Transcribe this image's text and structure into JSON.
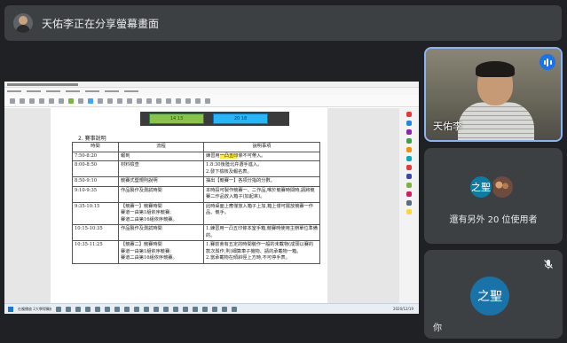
{
  "banner": {
    "message": "天佑李正在分享螢幕畫面",
    "avatar_icon": "user-avatar"
  },
  "shared_screen": {
    "doc_boxes": {
      "green_label": "14 13",
      "blue_label": "20 18"
    },
    "section_title": "2. 賽事說明",
    "table": {
      "headers": [
        "時間",
        "流程",
        "說明事項"
      ],
      "rows": [
        {
          "time": "7:50-8:20",
          "flow": "報到",
          "note_pre": "練習用",
          "note_hl": "一凸五印",
          "note_post": "條不可帶入。"
        },
        {
          "time": "8:00-8:50",
          "flow": "材料檢查",
          "note": "1.8:30後陸北弁選手進入。\n2.發下檢核及報名表。"
        },
        {
          "time": "8:50-9:10",
          "flow": "競賽式暨規則說明",
          "note": "抽出【競賽一】各項分指的分數。"
        },
        {
          "time": "9:10-9:35",
          "flow": "作品製作及測試時間",
          "note": "本時段可製作競賽一、二作品,唯於競賽時間時,請將競賽二作品放入箱子(加起來)。"
        },
        {
          "time": "9:35-10:15",
          "flow": "【競賽一】競賽時間\n賽道一由第1組依序競賽;\n賽道二由第16組依序競賽。",
          "note": "此時桌面上應僅放入箱子上加,箱上僅可擺放競賽一作品、競手。"
        },
        {
          "time": "10:15-10:35",
          "flow": "作品製作及測試時間",
          "note": "1.練習用一凸五印條本室手箱,競賽時使用主辦單位準備的。"
        },
        {
          "time": "10:35-11:25",
          "flow": "【競賽二】競賽時間\n賽道一由第1組依序競賽;\n賽道二由第16組依序競賽。",
          "note": "1.賽前會有五定的時間裝作一般的未載物(成頭以賽的款次與作,則)細算車子機物、請的承載物一箱。\n2.當承載物在傾斜徑上方時,不可停手表。"
        }
      ]
    },
    "taskbar": {
      "task_label": "在複播放 2大學得醫練",
      "clock": "2020/12/19"
    }
  },
  "tiles": {
    "presenter": {
      "name": "天佑李"
    },
    "others": {
      "avatar_text": "之聖",
      "text": "還有另外 20 位使用者"
    },
    "self": {
      "avatar_text": "之聖",
      "name": "你"
    }
  },
  "colors": {
    "accent": "#1a73e8",
    "tile_bg": "#3c4043",
    "page_bg": "#202124"
  }
}
